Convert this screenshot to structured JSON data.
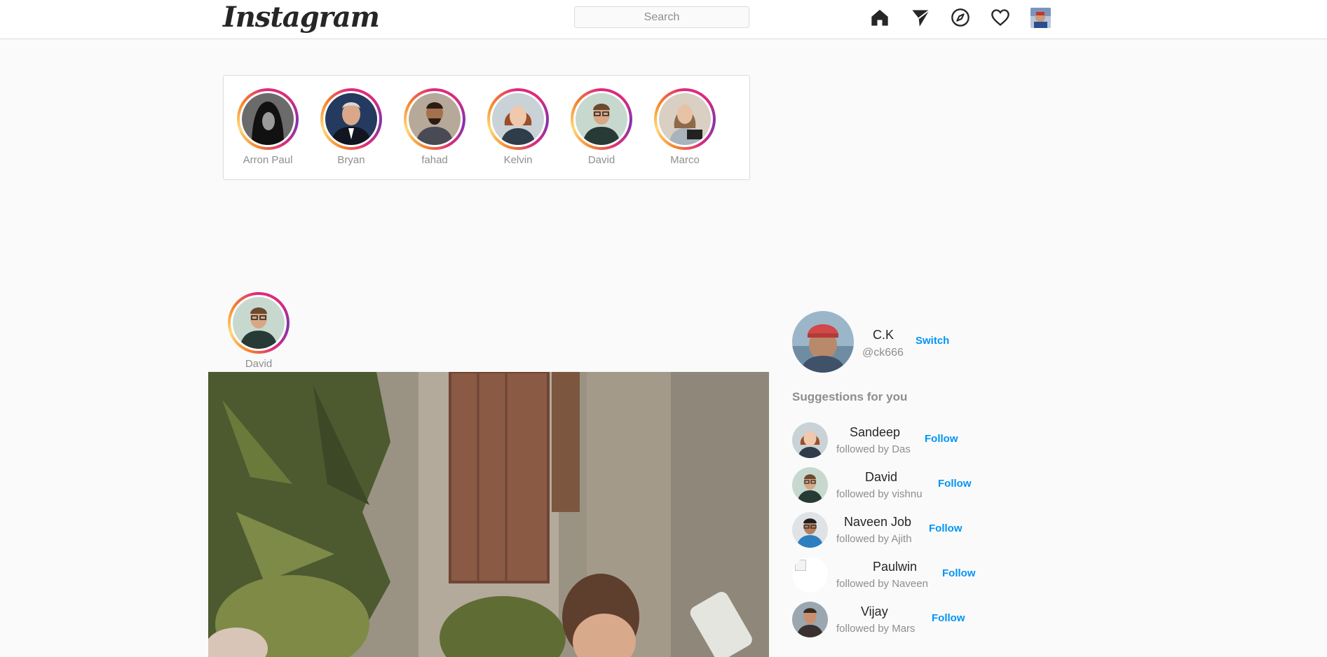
{
  "header": {
    "logo": "Instagram",
    "search_placeholder": "Search",
    "nav": [
      "home-icon",
      "send-icon",
      "explore-icon",
      "heart-icon",
      "profile-avatar"
    ]
  },
  "stories": [
    {
      "name": "Arron Paul"
    },
    {
      "name": "Bryan"
    },
    {
      "name": "fahad"
    },
    {
      "name": "Kelvin"
    },
    {
      "name": "David"
    },
    {
      "name": "Marco"
    }
  ],
  "post": {
    "author": "David"
  },
  "sidebar": {
    "profile": {
      "name": "C.K",
      "handle": "@ck666",
      "switch_label": "Switch"
    },
    "suggestions_title": "Suggestions for you",
    "suggestions": [
      {
        "name": "Sandeep",
        "followed_by": "followed by Das",
        "action": "Follow"
      },
      {
        "name": "David",
        "followed_by": "followed by vishnu",
        "action": "Follow"
      },
      {
        "name": "Naveen Job",
        "followed_by": "followed by Ajith",
        "action": "Follow"
      },
      {
        "name": "Paulwin",
        "followed_by": "followed by Naveen",
        "action": "Follow"
      },
      {
        "name": "Vijay",
        "followed_by": "followed by Mars",
        "action": "Follow"
      }
    ]
  },
  "colors": {
    "accent": "#0095f6",
    "muted": "#8e8e8e",
    "border": "#dbdbdb",
    "background": "#fafafa"
  }
}
